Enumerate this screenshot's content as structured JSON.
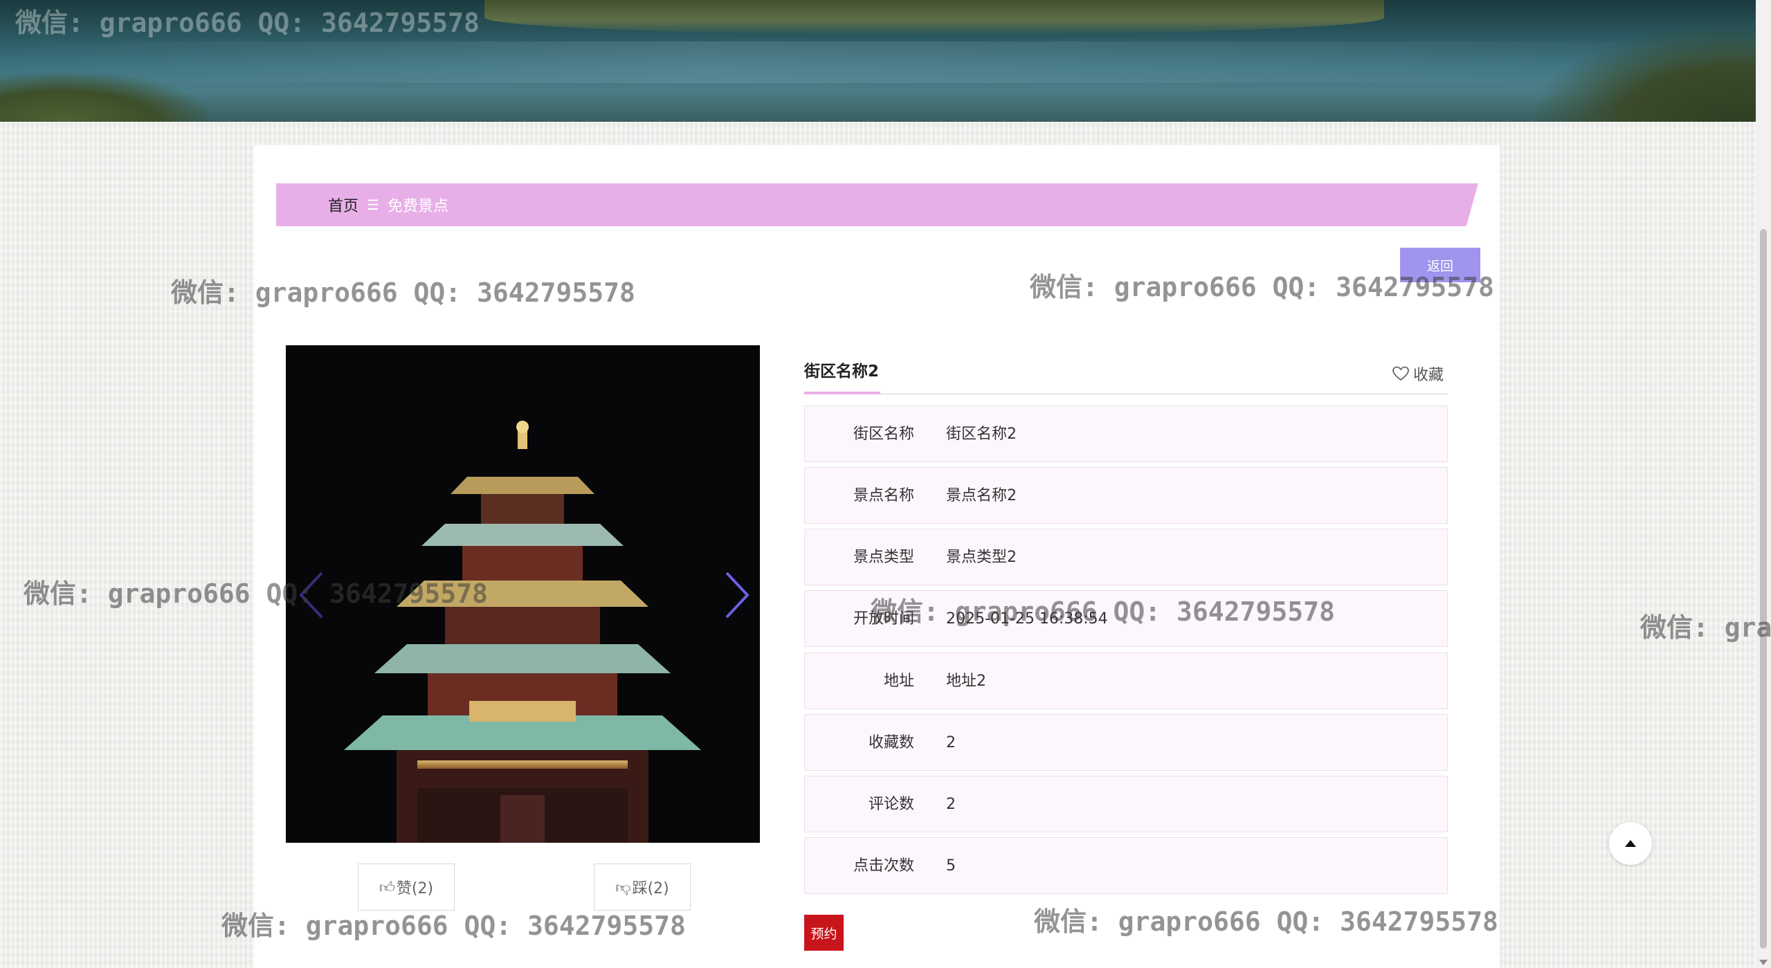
{
  "breadcrumb": {
    "home": "首页",
    "separator": "☰",
    "current": "免费景点"
  },
  "back_button": "返回",
  "gallery": {
    "prev_icon": "chevron-left-icon",
    "next_icon": "chevron-right-icon"
  },
  "votes": {
    "like": "赞(2)",
    "dislike": "踩(2)"
  },
  "detail": {
    "title": "街区名称2",
    "favorite": "收藏",
    "rows": [
      {
        "label": "街区名称",
        "value": "街区名称2"
      },
      {
        "label": "景点名称",
        "value": "景点名称2"
      },
      {
        "label": "景点类型",
        "value": "景点类型2"
      },
      {
        "label": "开放时间",
        "value": "2025-01-25 16:38:54"
      },
      {
        "label": "地址",
        "value": "地址2"
      },
      {
        "label": "收藏数",
        "value": "2"
      },
      {
        "label": "评论数",
        "value": "2"
      },
      {
        "label": "点击次数",
        "value": "5"
      }
    ],
    "book_button": "预约"
  },
  "watermark": "微信: grapro666 QQ: 3642795578",
  "watermark_partial": "微信: gra",
  "colors": {
    "breadcrumb_bg": "#e8aee8",
    "back_button_bg": "#9f95ee",
    "book_button_bg": "#c8141b",
    "row_bg": "#fdf7fd"
  }
}
